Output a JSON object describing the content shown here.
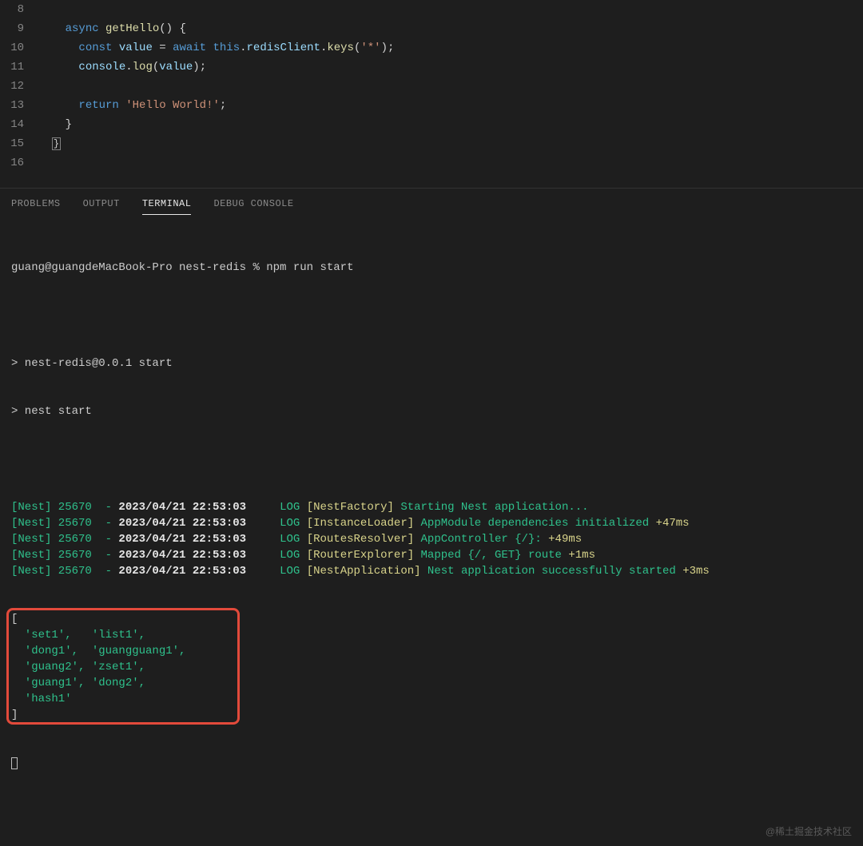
{
  "editor": {
    "lines": [
      {
        "n": "8",
        "html": ""
      },
      {
        "n": "9",
        "html": "    <span class='tok-kw'>async</span> <span class='tok-fn'>getHello</span><span class='tok-paren'>()</span> <span class='tok-punc'>{</span>"
      },
      {
        "n": "10",
        "html": "      <span class='tok-kw'>const</span> <span class='tok-var'>value</span> <span class='tok-punc'>=</span> <span class='tok-kw'>await</span> <span class='tok-this'>this</span><span class='tok-punc'>.</span><span class='tok-prop'>redisClient</span><span class='tok-punc'>.</span><span class='tok-call'>keys</span><span class='tok-paren'>(</span><span class='tok-str'>'*'</span><span class='tok-paren'>)</span><span class='tok-punc'>;</span>"
      },
      {
        "n": "11",
        "html": "      <span class='tok-var'>console</span><span class='tok-punc'>.</span><span class='tok-call'>log</span><span class='tok-paren'>(</span><span class='tok-var'>value</span><span class='tok-paren'>)</span><span class='tok-punc'>;</span>"
      },
      {
        "n": "12",
        "html": ""
      },
      {
        "n": "13",
        "html": "      <span class='tok-kw'>return</span> <span class='tok-str'>'Hello World!'</span><span class='tok-punc'>;</span>"
      },
      {
        "n": "14",
        "html": "    <span class='tok-punc'>}</span>"
      },
      {
        "n": "15",
        "html": "  <span class='cursor-end'>}</span>"
      },
      {
        "n": "16",
        "html": ""
      }
    ]
  },
  "panel": {
    "tabs": {
      "problems": "PROBLEMS",
      "output": "OUTPUT",
      "terminal": "TERMINAL",
      "debug_console": "DEBUG CONSOLE"
    }
  },
  "terminal": {
    "prompt_line": "guang@guangdeMacBook-Pro nest-redis % npm run start",
    "script_echo1": "> nest-redis@0.0.1 start",
    "script_echo2": "> nest start",
    "logs": [
      {
        "prefix": "[Nest] 25670  - ",
        "ts": "2023/04/21 22:53:03",
        "level": "LOG",
        "tag": "[NestFactory]",
        "msg": " Starting Nest application...",
        "extra": ""
      },
      {
        "prefix": "[Nest] 25670  - ",
        "ts": "2023/04/21 22:53:03",
        "level": "LOG",
        "tag": "[InstanceLoader]",
        "msg": " AppModule dependencies initialized ",
        "extra": "+47ms"
      },
      {
        "prefix": "[Nest] 25670  - ",
        "ts": "2023/04/21 22:53:03",
        "level": "LOG",
        "tag": "[RoutesResolver]",
        "msg": " AppController {/}: ",
        "extra": "+49ms"
      },
      {
        "prefix": "[Nest] 25670  - ",
        "ts": "2023/04/21 22:53:03",
        "level": "LOG",
        "tag": "[RouterExplorer]",
        "msg": " Mapped {/, GET} route ",
        "extra": "+1ms"
      },
      {
        "prefix": "[Nest] 25670  - ",
        "ts": "2023/04/21 22:53:03",
        "level": "LOG",
        "tag": "[NestApplication]",
        "msg": " Nest application successfully started ",
        "extra": "+3ms"
      }
    ],
    "array_output": {
      "open": "[",
      "rows": [
        "  'set1',   'list1',",
        "  'dong1',  'guangguang1',",
        "  'guang2', 'zset1',",
        "  'guang1', 'dong2',",
        "  'hash1'"
      ],
      "close": "]"
    }
  },
  "watermark": "@稀土掘金技术社区"
}
